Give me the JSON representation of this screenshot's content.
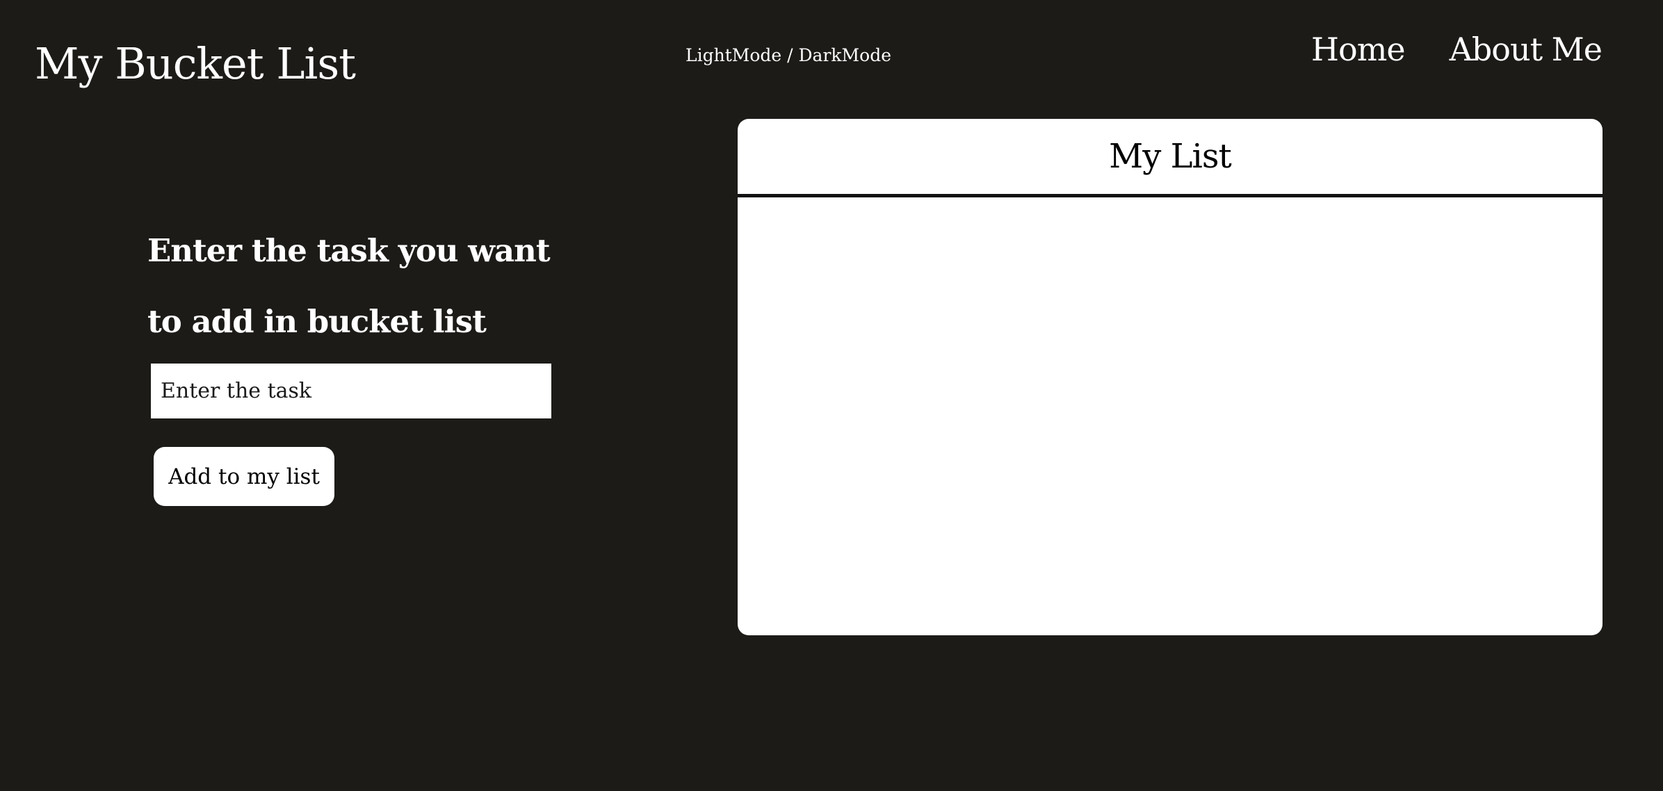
{
  "header": {
    "title": "My Bucket List",
    "mode_toggle": "LightMode / DarkMode",
    "nav": [
      "Home",
      "About Me"
    ]
  },
  "form": {
    "prompt": "Enter the task you want to add in bucket list",
    "input_placeholder": "Enter the task",
    "input_value": "",
    "add_button": "Add to my list"
  },
  "list": {
    "title": "My List",
    "items": []
  },
  "colors": {
    "background": "#1c1b18",
    "text": "#ffffff",
    "panel": "#ffffff",
    "panel_text": "#000000"
  }
}
